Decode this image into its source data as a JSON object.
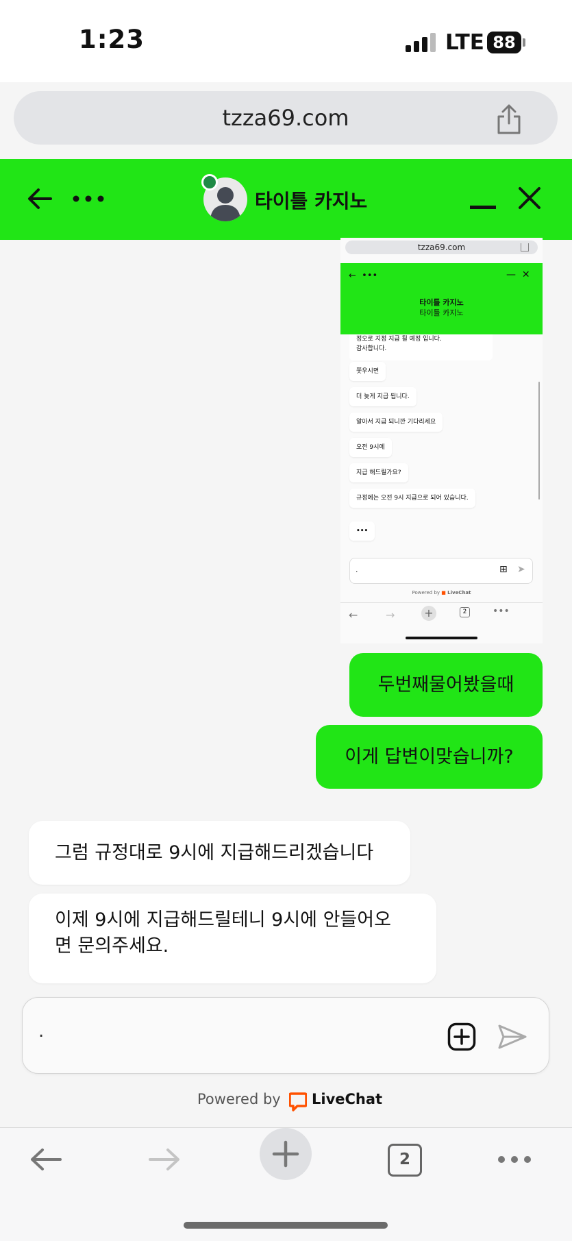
{
  "status_bar": {
    "time": "1:23",
    "network": "LTE",
    "battery": "88"
  },
  "browser": {
    "url": "tzza69.com",
    "tab_count": "2"
  },
  "chat_header": {
    "title": "타이틀 카지노"
  },
  "embedded_screenshot": {
    "url": "tzza69.com",
    "header_title": "타이틀 카지노",
    "header_subtitle": "타이틀 카지노",
    "top_bubble": "정오로 지정 지급 될 예정 입니다.\n감사합니다.",
    "messages": [
      "쫏우시면",
      "더 늦게 지급 됩니다.",
      "알아서 지급 되니깐 기다리세요",
      "오전 9시에",
      "지급 해드릴가요?",
      "규정에는 오전 9시 지급으로 되어 있습니다.",
      "•••"
    ],
    "input_value": ".",
    "powered_by": "Powered by",
    "brand": "LiveChat",
    "tab_count": "2"
  },
  "messages": {
    "outgoing": [
      "두번째물어봤을때",
      "이게 답변이맞습니까?"
    ],
    "incoming": [
      "그럼 규정대로 9시에 지급해드리겠습니다",
      "이제 9시에 지급해드릴테니 9시에 안들어오\n면 문의주세요."
    ]
  },
  "composer": {
    "value": "."
  },
  "footer": {
    "powered_by": "Powered by",
    "brand": "LiveChat"
  },
  "colors": {
    "header_green": "#21e516",
    "bubble_green": "#21e516",
    "livechat_orange": "#ff5100",
    "avatar_dot": "#1f8a45"
  }
}
